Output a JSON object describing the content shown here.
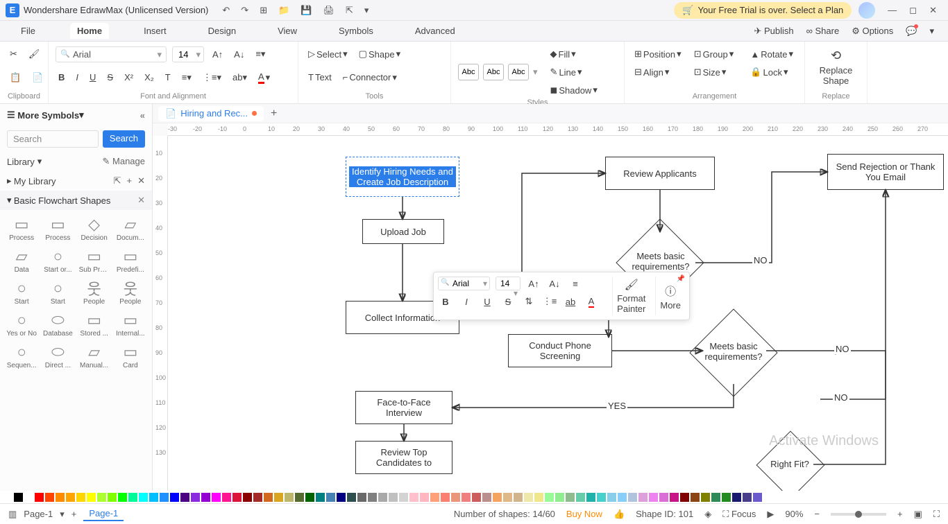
{
  "app": {
    "title": "Wondershare EdrawMax (Unlicensed Version)"
  },
  "trial": {
    "text": "Your Free Trial is over. Select a Plan"
  },
  "menu": {
    "file": "File",
    "home": "Home",
    "insert": "Insert",
    "design": "Design",
    "view": "View",
    "symbols": "Symbols",
    "advanced": "Advanced",
    "publish": "Publish",
    "share": "Share",
    "options": "Options"
  },
  "ribbon": {
    "clipboard": "Clipboard",
    "font_align": "Font and Alignment",
    "tools": "Tools",
    "styles": "Styles",
    "arrangement": "Arrangement",
    "replace": "Replace",
    "font": "Arial",
    "size": "14",
    "select": "Select",
    "shape": "Shape",
    "text": "Text",
    "connector": "Connector",
    "abc": "Abc",
    "fill": "Fill",
    "line": "Line",
    "shadow": "Shadow",
    "position": "Position",
    "align": "Align",
    "group": "Group",
    "size_btn": "Size",
    "rotate": "Rotate",
    "lock": "Lock",
    "replace_shape": "Replace\nShape"
  },
  "sidebar": {
    "title": "More Symbols",
    "search_placeholder": "Search",
    "search_btn": "Search",
    "library": "Library",
    "manage": "Manage",
    "my_library": "My Library",
    "section": "Basic Flowchart Shapes",
    "shapes": [
      "Process",
      "Process",
      "Decision",
      "Docum...",
      "Data",
      "Start or...",
      "Sub Pro...",
      "Predefi...",
      "Start",
      "Start",
      "People",
      "People",
      "Yes or No",
      "Database",
      "Stored ...",
      "Internal...",
      "Sequen...",
      "Direct ...",
      "Manual...",
      "Card"
    ]
  },
  "doc_tab": "Hiring and Rec...",
  "ruler_h": [
    "-30",
    "-20",
    "-10",
    "0",
    "10",
    "20",
    "30",
    "40",
    "50",
    "60",
    "70",
    "80",
    "90",
    "100",
    "110",
    "120",
    "130",
    "140",
    "150",
    "160",
    "170",
    "180",
    "190",
    "200",
    "210",
    "220",
    "230",
    "240",
    "250",
    "260",
    "270"
  ],
  "ruler_v": [
    "10",
    "20",
    "30",
    "40",
    "50",
    "60",
    "70",
    "80",
    "90",
    "100",
    "110",
    "120",
    "130"
  ],
  "flowchart": {
    "n1": "Identify Hiring Needs and Create Job Description",
    "n2": "Upload Job",
    "n3": "Collect Information",
    "n4": "Review Applicants",
    "n5": "Meets basic requirements?",
    "n6": "Send Rejection or Thank You Email",
    "n7": "Conduct Phone Screening",
    "n8": "Meets basic requirements?",
    "n9": "Face-to-Face Interview",
    "n10": "Review Top Candidates to",
    "n11": "Right Fit?",
    "yes": "YES",
    "no": "NO"
  },
  "float": {
    "font": "Arial",
    "size": "14",
    "format_painter": "Format\nPainter",
    "more": "More"
  },
  "status": {
    "page": "Page-1",
    "page_tab": "Page-1",
    "shapes": "Number of shapes: 14/60",
    "buy": "Buy Now",
    "shape_id": "Shape ID: 101",
    "focus": "Focus",
    "zoom": "90%"
  },
  "watermark": "Activate Windows",
  "colors": [
    "#000",
    "#fff",
    "#ff0000",
    "#ff4500",
    "#ff8c00",
    "#ffa500",
    "#ffd700",
    "#ffff00",
    "#adff2f",
    "#7fff00",
    "#00ff00",
    "#00fa9a",
    "#00ffff",
    "#00bfff",
    "#1e90ff",
    "#0000ff",
    "#4b0082",
    "#8a2be2",
    "#9400d3",
    "#ff00ff",
    "#ff1493",
    "#dc143c",
    "#8b0000",
    "#a52a2a",
    "#d2691e",
    "#daa520",
    "#bdb76b",
    "#556b2f",
    "#006400",
    "#008080",
    "#4682b4",
    "#000080",
    "#2f4f4f",
    "#696969",
    "#808080",
    "#a9a9a9",
    "#c0c0c0",
    "#d3d3d3",
    "#ffc0cb",
    "#ffb6c1",
    "#ffa07a",
    "#fa8072",
    "#e9967a",
    "#f08080",
    "#cd5c5c",
    "#bc8f8f",
    "#f4a460",
    "#deb887",
    "#d2b48c",
    "#eee8aa",
    "#f0e68c",
    "#98fb98",
    "#90ee90",
    "#8fbc8f",
    "#66cdaa",
    "#20b2aa",
    "#48d1cc",
    "#87ceeb",
    "#87cefa",
    "#b0c4de",
    "#dda0dd",
    "#ee82ee",
    "#da70d6",
    "#c71585",
    "#800000",
    "#8b4513",
    "#808000",
    "#2e8b57",
    "#228b22",
    "#191970",
    "#483d8b",
    "#6a5acd"
  ]
}
